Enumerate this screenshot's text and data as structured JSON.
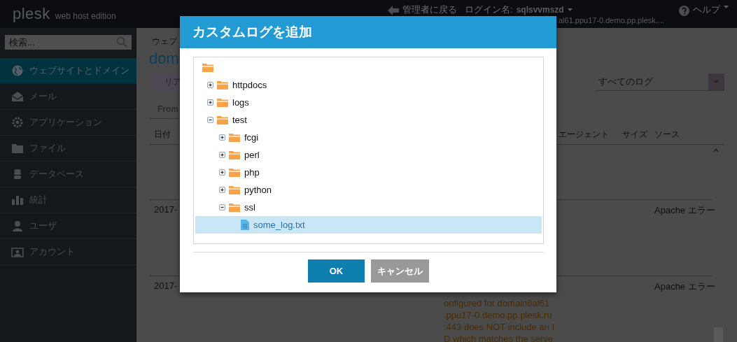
{
  "header": {
    "logo": "plesk",
    "edition": "web host edition",
    "back_link": "管理者に戻る",
    "login_label": "ログイン名:",
    "login_user": "sqlsvvmszd",
    "subscription": "al61.ppu17-0.demo.pp.plesk....",
    "help": "ヘルプ"
  },
  "sidebar": {
    "search": {
      "placeholder": "検索..."
    },
    "items": [
      {
        "label": "ウェブサイトとドメイン",
        "selected": true
      },
      {
        "label": "メール",
        "selected": false
      },
      {
        "label": "アプリケーション",
        "selected": false
      },
      {
        "label": "ファイル",
        "selected": false
      },
      {
        "label": "データベース",
        "selected": false
      },
      {
        "label": "統計",
        "selected": false
      },
      {
        "label": "ユーザ",
        "selected": false
      },
      {
        "label": "アカウント",
        "selected": false
      }
    ]
  },
  "main": {
    "breadcrumb": "ウェブ",
    "title": "dom",
    "toolbar_button": "リア",
    "filter_tab": "From",
    "log_select": "すべてのログ",
    "table": {
      "columns": [
        {
          "label": "日付"
        },
        {
          "label": "エージェント"
        },
        {
          "label": "サイズ"
        },
        {
          "label": "ソース"
        }
      ],
      "rows": [
        {
          "date": "2017-",
          "source": "Apache エラー"
        },
        {
          "date": "2017-",
          "source": "Apache エラー",
          "message": "onfigured for domain8al61\n.ppu17-0.demo.pp.plesk.ru\n:443 does NOT include an I\nD which matches the serve"
        }
      ]
    }
  },
  "dialog": {
    "title": "カスタムログを追加",
    "tree": [
      {
        "kind": "folder",
        "selected": false,
        "children": [
          {
            "kind": "folder",
            "name": "httpdocs",
            "expanded": false,
            "selected": false
          },
          {
            "kind": "folder",
            "name": "logs",
            "expanded": false,
            "selected": false
          },
          {
            "kind": "folder",
            "name": "test",
            "expanded": true,
            "selected": false,
            "children": [
              {
                "kind": "folder",
                "name": "fcgi",
                "expanded": false,
                "selected": false
              },
              {
                "kind": "folder",
                "name": "perl",
                "expanded": false,
                "selected": false
              },
              {
                "kind": "folder",
                "name": "php",
                "expanded": false,
                "selected": false
              },
              {
                "kind": "folder",
                "name": "python",
                "expanded": false,
                "selected": false
              },
              {
                "kind": "folder",
                "name": "ssl",
                "expanded": true,
                "selected": false,
                "children": [
                  {
                    "kind": "file",
                    "name": "some_log.txt",
                    "selected": true
                  }
                ]
              }
            ]
          }
        ]
      }
    ],
    "buttons": [
      {
        "label": "OK",
        "kind": "primary"
      },
      {
        "label": "キャンセル",
        "kind": "secondary"
      }
    ]
  }
}
